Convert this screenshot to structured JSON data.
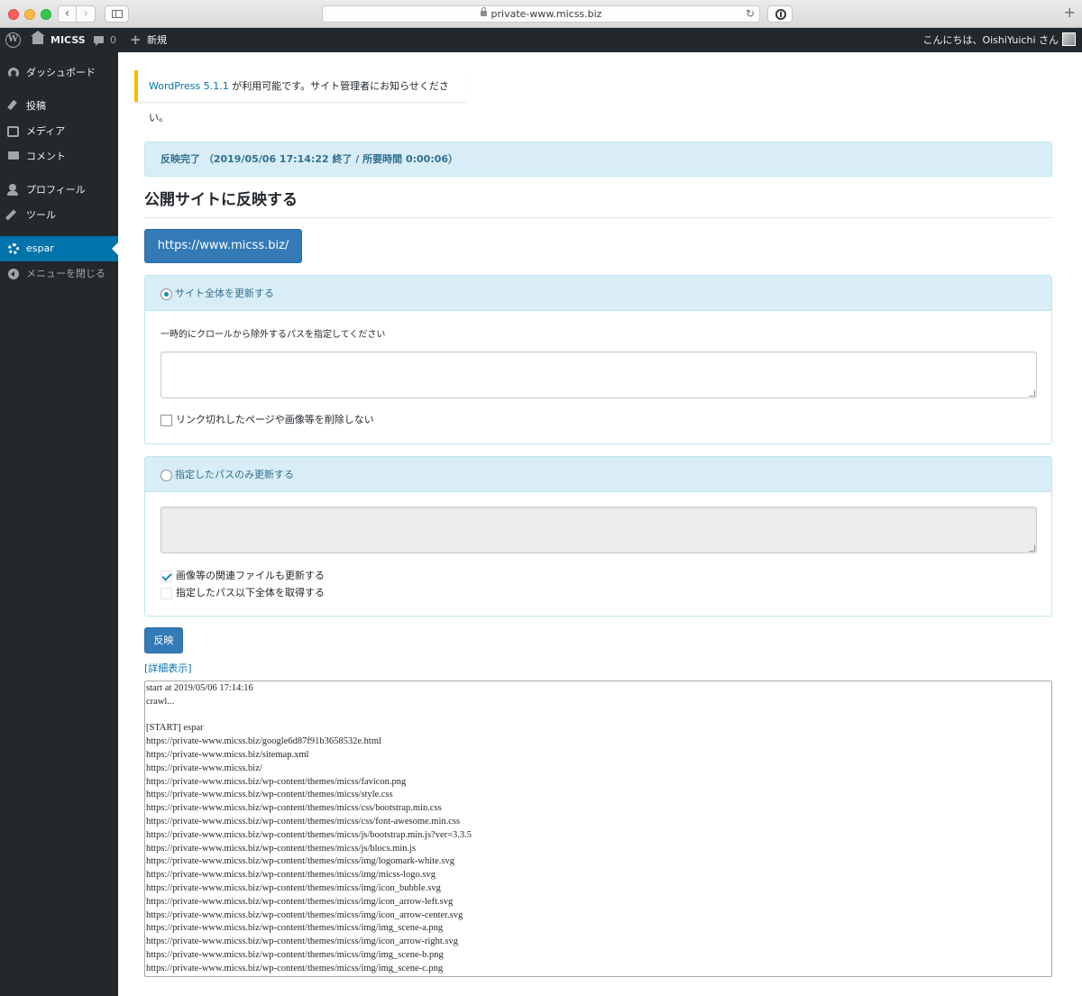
{
  "browser": {
    "url": "private-www.micss.biz",
    "back_icon": "chevron-left-icon",
    "forward_icon": "chevron-right-icon"
  },
  "admin_bar": {
    "site_name": "MICSS",
    "comment_count": "0",
    "new_label": "新規",
    "greeting": "こんにちは、OishiYuichi さん"
  },
  "menu": {
    "items": [
      {
        "label": "ダッシュボード",
        "icon": "dashboard-icon"
      },
      {
        "label": "投稿",
        "icon": "pushpin-icon"
      },
      {
        "label": "メディア",
        "icon": "media-icon"
      },
      {
        "label": "コメント",
        "icon": "comment-icon"
      },
      {
        "label": "プロフィール",
        "icon": "user-icon"
      },
      {
        "label": "ツール",
        "icon": "wrench-icon"
      },
      {
        "label": "espar",
        "icon": "gear-icon",
        "active": true
      },
      {
        "label": "メニューを閉じる",
        "icon": "collapse-icon"
      }
    ]
  },
  "notice": {
    "link_text": "WordPress 5.1.1",
    "message": " が利用可能です。サイト管理者にお知らせください。"
  },
  "status": {
    "text": "反映完了 （2019/05/06 17:14:22 終了 / 所要時間 0:00:06）"
  },
  "page": {
    "title": "公開サイトに反映する",
    "site_button": "https://www.micss.biz/"
  },
  "panel_full": {
    "radio_label": "サイト全体を更新する",
    "selected": true,
    "exclude_label": "一時的にクロールから除外するパスを指定してください",
    "exclude_value": "",
    "keep_broken_label": "リンク切れしたページや画像等を削除しない",
    "keep_broken_checked": false
  },
  "panel_path": {
    "radio_label": "指定したパスのみ更新する",
    "selected": false,
    "path_value": "",
    "related_files_label": "画像等の関連ファイルも更新する",
    "related_files_checked": true,
    "subtree_label": "指定したパス以下全体を取得する",
    "subtree_checked": false
  },
  "actions": {
    "submit_label": "反映",
    "detail_link": "[詳細表示]"
  },
  "log": {
    "lines": [
      "start at 2019/05/06 17:14:16",
      "crawl...",
      "",
      "[START] espar",
      "https://private-www.micss.biz/google6d87f91b3658532e.html",
      "https://private-www.micss.biz/sitemap.xml",
      "https://private-www.micss.biz/",
      "https://private-www.micss.biz/wp-content/themes/micss/favicon.png",
      "https://private-www.micss.biz/wp-content/themes/micss/style.css",
      "https://private-www.micss.biz/wp-content/themes/micss/css/bootstrap.min.css",
      "https://private-www.micss.biz/wp-content/themes/micss/css/font-awesome.min.css",
      "https://private-www.micss.biz/wp-content/themes/micss/js/bootstrap.min.js?ver=3.3.5",
      "https://private-www.micss.biz/wp-content/themes/micss/js/blocs.min.js",
      "https://private-www.micss.biz/wp-content/themes/micss/img/logomark-white.svg",
      "https://private-www.micss.biz/wp-content/themes/micss/img/micss-logo.svg",
      "https://private-www.micss.biz/wp-content/themes/micss/img/icon_bubble.svg",
      "https://private-www.micss.biz/wp-content/themes/micss/img/icon_arrow-left.svg",
      "https://private-www.micss.biz/wp-content/themes/micss/img/icon_arrow-center.svg",
      "https://private-www.micss.biz/wp-content/themes/micss/img/img_scene-a.png",
      "https://private-www.micss.biz/wp-content/themes/micss/img/icon_arrow-right.svg",
      "https://private-www.micss.biz/wp-content/themes/micss/img/img_scene-b.png",
      "https://private-www.micss.biz/wp-content/themes/micss/img/img_scene-c.png"
    ]
  }
}
